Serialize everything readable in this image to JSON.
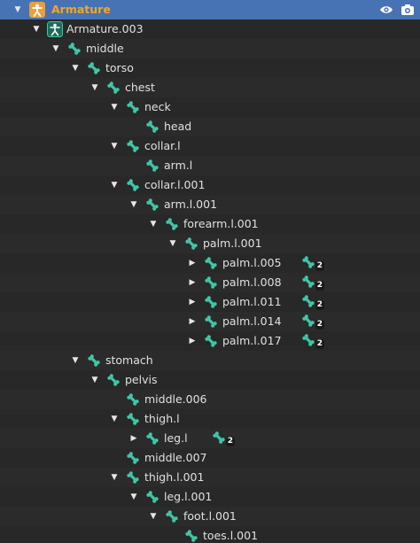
{
  "outliner": {
    "header": {
      "label": "Armature",
      "eye_icon": "eye-icon",
      "camera_icon": "camera-icon"
    },
    "rows": [
      {
        "label": "Armature.003",
        "depth": 1,
        "expand": "open",
        "icon": "armature-data-icon",
        "badge": null
      },
      {
        "label": "middle",
        "depth": 2,
        "expand": "open",
        "icon": "bone-icon",
        "badge": null
      },
      {
        "label": "torso",
        "depth": 3,
        "expand": "open",
        "icon": "bone-icon",
        "badge": null
      },
      {
        "label": "chest",
        "depth": 4,
        "expand": "open",
        "icon": "bone-icon",
        "badge": null
      },
      {
        "label": "neck",
        "depth": 5,
        "expand": "open",
        "icon": "bone-icon",
        "badge": null
      },
      {
        "label": "head",
        "depth": 6,
        "expand": "none",
        "icon": "bone-icon",
        "badge": null
      },
      {
        "label": "collar.l",
        "depth": 5,
        "expand": "open",
        "icon": "bone-icon",
        "badge": null
      },
      {
        "label": "arm.l",
        "depth": 6,
        "expand": "none",
        "icon": "bone-icon",
        "badge": null
      },
      {
        "label": "collar.l.001",
        "depth": 5,
        "expand": "open",
        "icon": "bone-icon",
        "badge": null
      },
      {
        "label": "arm.l.001",
        "depth": 6,
        "expand": "open",
        "icon": "bone-icon",
        "badge": null
      },
      {
        "label": "forearm.l.001",
        "depth": 7,
        "expand": "open",
        "icon": "bone-icon",
        "badge": null
      },
      {
        "label": "palm.l.001",
        "depth": 8,
        "expand": "open",
        "icon": "bone-icon",
        "badge": null
      },
      {
        "label": "palm.l.005",
        "depth": 9,
        "expand": "closed",
        "icon": "bone-icon",
        "badge": "2"
      },
      {
        "label": "palm.l.008",
        "depth": 9,
        "expand": "closed",
        "icon": "bone-icon",
        "badge": "2"
      },
      {
        "label": "palm.l.011",
        "depth": 9,
        "expand": "closed",
        "icon": "bone-icon",
        "badge": "2"
      },
      {
        "label": "palm.l.014",
        "depth": 9,
        "expand": "closed",
        "icon": "bone-icon",
        "badge": "2"
      },
      {
        "label": "palm.l.017",
        "depth": 9,
        "expand": "closed",
        "icon": "bone-icon",
        "badge": "2"
      },
      {
        "label": "stomach",
        "depth": 3,
        "expand": "open",
        "icon": "bone-icon",
        "badge": null
      },
      {
        "label": "pelvis",
        "depth": 4,
        "expand": "open",
        "icon": "bone-icon",
        "badge": null
      },
      {
        "label": "middle.006",
        "depth": 5,
        "expand": "none",
        "icon": "bone-icon",
        "badge": null
      },
      {
        "label": "thigh.l",
        "depth": 5,
        "expand": "open",
        "icon": "bone-icon",
        "badge": null
      },
      {
        "label": "leg.l",
        "depth": 6,
        "expand": "closed",
        "icon": "bone-icon",
        "badge": "2"
      },
      {
        "label": "middle.007",
        "depth": 5,
        "expand": "none",
        "icon": "bone-icon",
        "badge": null
      },
      {
        "label": "thigh.l.001",
        "depth": 5,
        "expand": "open",
        "icon": "bone-icon",
        "badge": null
      },
      {
        "label": "leg.l.001",
        "depth": 6,
        "expand": "open",
        "icon": "bone-icon",
        "badge": null
      },
      {
        "label": "foot.l.001",
        "depth": 7,
        "expand": "open",
        "icon": "bone-icon",
        "badge": null
      },
      {
        "label": "toes.l.001",
        "depth": 8,
        "expand": "none",
        "icon": "bone-icon",
        "badge": null
      }
    ]
  },
  "colors": {
    "background": "#2b2b2b",
    "header_bg": "#4772b3",
    "header_text": "#f5a623",
    "bone_icon": "#3fc6a6",
    "text": "#e0e0e0"
  }
}
